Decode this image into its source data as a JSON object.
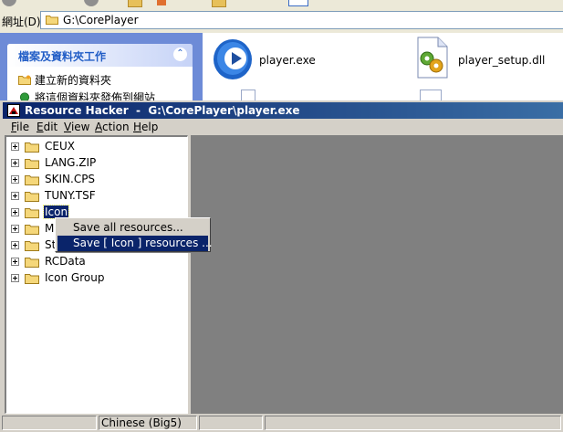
{
  "explorer": {
    "address_label": "網址(D)",
    "address_value": "G:\\CorePlayer",
    "tasks_panel": {
      "title": "檔案及資料夾工作",
      "items": [
        {
          "label": "建立新的資料夾"
        },
        {
          "label": "將這個資料夾發佈到網站"
        }
      ]
    },
    "files": [
      {
        "name": "player.exe",
        "icon": "media-player-icon"
      },
      {
        "name": "player_setup.dll",
        "icon": "dll-gear-icon"
      }
    ]
  },
  "resource_hacker": {
    "title": "Resource Hacker  -  G:\\CorePlayer\\player.exe",
    "menu": [
      {
        "label": "File",
        "mnemonic": "F"
      },
      {
        "label": "Edit",
        "mnemonic": "E"
      },
      {
        "label": "View",
        "mnemonic": "V"
      },
      {
        "label": "Action",
        "mnemonic": "A"
      },
      {
        "label": "Help",
        "mnemonic": "H"
      }
    ],
    "tree": [
      {
        "label": "CEUX"
      },
      {
        "label": "LANG.ZIP"
      },
      {
        "label": "SKIN.CPS"
      },
      {
        "label": "TUNY.TSF"
      },
      {
        "label": "Icon",
        "selected": true
      },
      {
        "label": "Me"
      },
      {
        "label": "Str"
      },
      {
        "label": "RCData"
      },
      {
        "label": "Icon Group"
      }
    ],
    "context_menu": [
      {
        "label": "Save all resources...",
        "highlighted": false
      },
      {
        "label": "Save [ Icon ] resources ...",
        "highlighted": true
      }
    ],
    "status": {
      "encoding": "Chinese (Big5)"
    }
  },
  "colors": {
    "titlebar_start": "#0a246a",
    "titlebar_end": "#3a6ea5",
    "selection": "#0a246a",
    "tasks_accent": "#215dc6"
  }
}
